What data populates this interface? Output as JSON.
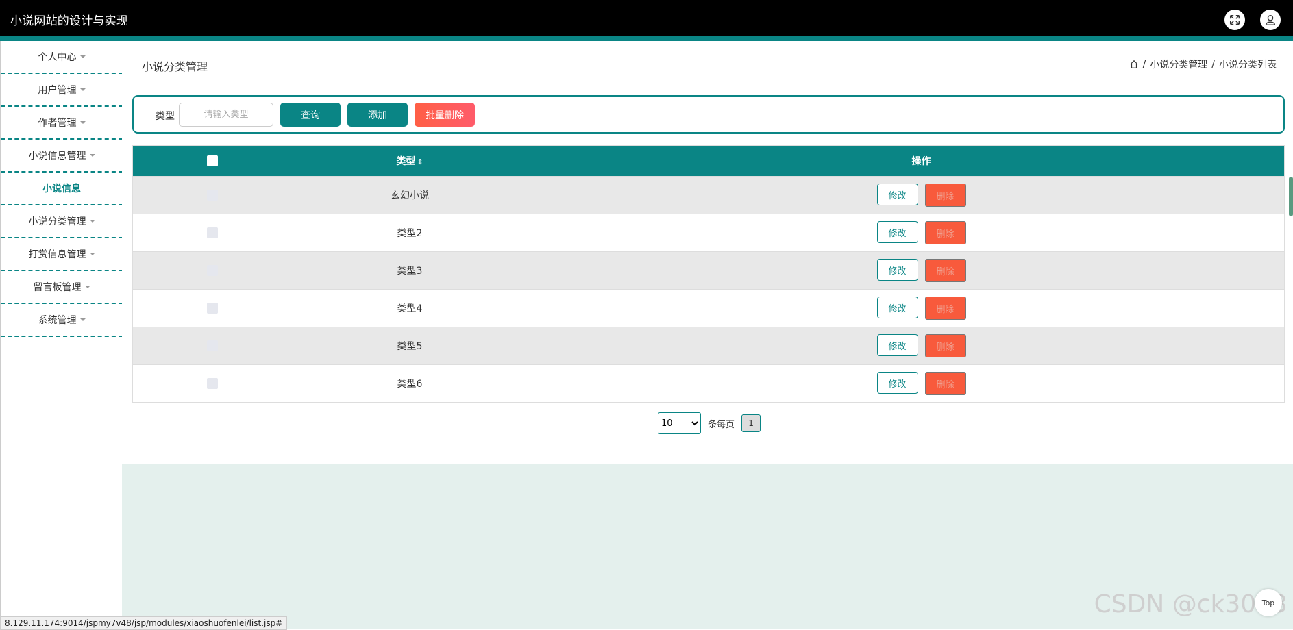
{
  "header": {
    "title": "小说网站的设计与实现",
    "fullscreen_icon": "expand-icon",
    "user_icon": "user-icon"
  },
  "sidebar": {
    "items": [
      {
        "label": "个人中心",
        "caret": true,
        "active": false
      },
      {
        "label": "用户管理",
        "caret": true,
        "active": false
      },
      {
        "label": "作者管理",
        "caret": true,
        "active": false
      },
      {
        "label": "小说信息管理",
        "caret": true,
        "active": false
      },
      {
        "label": "小说信息",
        "caret": false,
        "active": true
      },
      {
        "label": "小说分类管理",
        "caret": true,
        "active": false
      },
      {
        "label": "打赏信息管理",
        "caret": true,
        "active": false
      },
      {
        "label": "留言板管理",
        "caret": true,
        "active": false
      },
      {
        "label": "系统管理",
        "caret": true,
        "active": false
      }
    ]
  },
  "page": {
    "title": "小说分类管理",
    "breadcrumb": [
      "小说分类管理",
      "小说分类列表"
    ]
  },
  "search": {
    "label": "类型",
    "placeholder": "请输入类型",
    "query_label": "查询",
    "add_label": "添加",
    "batch_delete_label": "批量删除"
  },
  "table": {
    "columns": [
      "类型",
      "操作"
    ],
    "sort_icon": "⇕",
    "edit_label": "修改",
    "delete_label": "删除",
    "rows": [
      {
        "type": "玄幻小说"
      },
      {
        "type": "类型2"
      },
      {
        "type": "类型3"
      },
      {
        "type": "类型4"
      },
      {
        "type": "类型5"
      },
      {
        "type": "类型6"
      }
    ]
  },
  "pagination": {
    "page_size": "10",
    "per_page_label": "条每页",
    "current_page": "1"
  },
  "status_bar": {
    "url": "8.129.11.174:9014/jspmy7v48/jsp/modules/xiaoshuofenlei/list.jsp#"
  },
  "watermark": "CSDN @ck3013",
  "top_button": "Top",
  "colors": {
    "primary": "#0a8585",
    "danger": "#f85a3c",
    "footer_bg": "#e4f0ed"
  }
}
